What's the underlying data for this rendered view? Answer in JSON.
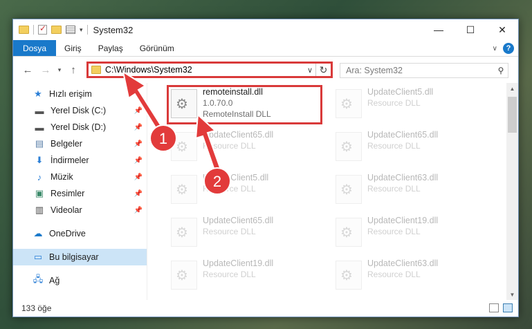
{
  "window": {
    "title": "System32"
  },
  "ribbon": {
    "tabs": [
      "Dosya",
      "Giriş",
      "Paylaş",
      "Görünüm"
    ]
  },
  "address": {
    "path": "C:\\Windows\\System32"
  },
  "search": {
    "placeholder": "Ara: System32"
  },
  "nav": {
    "quick_access": "Hızlı erişim",
    "items": [
      {
        "label": "Yerel Disk (C:)",
        "icon": "drive-icon"
      },
      {
        "label": "Yerel Disk (D:)",
        "icon": "drive-icon"
      },
      {
        "label": "Belgeler",
        "icon": "documents-icon"
      },
      {
        "label": "İndirmeler",
        "icon": "downloads-icon"
      },
      {
        "label": "Müzik",
        "icon": "music-icon"
      },
      {
        "label": "Resimler",
        "icon": "pictures-icon"
      },
      {
        "label": "Videolar",
        "icon": "videos-icon"
      }
    ],
    "onedrive": "OneDrive",
    "this_pc": "Bu bilgisayar",
    "network": "Ağ"
  },
  "files": [
    {
      "name": "remoteinstall.dll",
      "line2": "1.0.70.0",
      "line3": "RemoteInstall DLL",
      "faded": false
    },
    {
      "name": "UpdateClient5.dll",
      "line2": "Resource DLL",
      "faded": true
    },
    {
      "name": "UpdateClient65.dll",
      "line2": "Resource DLL",
      "faded": true
    },
    {
      "name": "UpdateClient65.dll",
      "line2": "Resource DLL",
      "faded": true
    },
    {
      "name": "UpdateClient5.dll",
      "line2": "Resource DLL",
      "faded": true
    },
    {
      "name": "UpdateClient63.dll",
      "line2": "Resource DLL",
      "faded": true
    },
    {
      "name": "UpdateClient65.dll",
      "line2": "Resource DLL",
      "faded": true
    },
    {
      "name": "UpdateClient19.dll",
      "line2": "Resource DLL",
      "faded": true
    },
    {
      "name": "UpdateClient19.dll",
      "line2": "Resource DLL",
      "faded": true
    },
    {
      "name": "UpdateClient63.dll",
      "line2": "Resource DLL",
      "faded": true
    }
  ],
  "status": {
    "count": "133 öğe"
  },
  "annotations": {
    "badge1": "1",
    "badge2": "2",
    "color": "#d93a3a"
  }
}
